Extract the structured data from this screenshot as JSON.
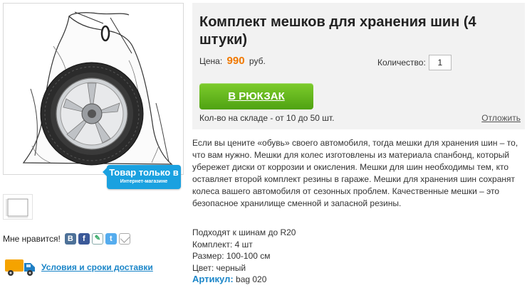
{
  "product": {
    "title": "Комплект мешков для хранения шин (4 штуки)",
    "price_label": "Цена:",
    "price_value": "990",
    "price_currency": "руб.",
    "quantity_label": "Количество:",
    "quantity_value": "1",
    "cart_button_label": "В РЮКЗАК",
    "stock_text": "Кол-во на складе - от 10 до 50 шт.",
    "postpone_label": "Отложить",
    "description": "Если вы цените «обувь» своего автомобиля, тогда мешки для хранения шин – то, что вам нужно. Мешки для колес изготовлены из материала спанбонд, который убережет диски от коррозии и окисления.  Мешки для шин необходимы тем, кто оставляет второй комплект резины в гараже. Мешки для хранения шин сохранят колеса вашего автомобиля от сезонных проблем. Качественные мешки – это безопасное хранилище сменной и запасной резины.",
    "specs": [
      "Подходят к шинам до R20",
      "Комплект: 4 шт",
      "Размер: 100-100 см",
      "Цвет: черный"
    ],
    "sku_label": "Артикул:",
    "sku_value": "bag 020"
  },
  "badge": {
    "line1": "Товар только в",
    "line2": "Интернет-магазине"
  },
  "social": {
    "like_label": "Мне нравится!",
    "icons": [
      "vk-icon",
      "facebook-icon",
      "livejournal-icon",
      "twitter-icon",
      "mail-icon"
    ]
  },
  "delivery": {
    "link_label": "Условия и сроки доставки",
    "icon": "truck-icon"
  },
  "colors": {
    "accent_green": "#5cb31b",
    "price_orange": "#f07800",
    "link_blue": "#1a85c8",
    "badge_blue": "#1aa1e0"
  }
}
